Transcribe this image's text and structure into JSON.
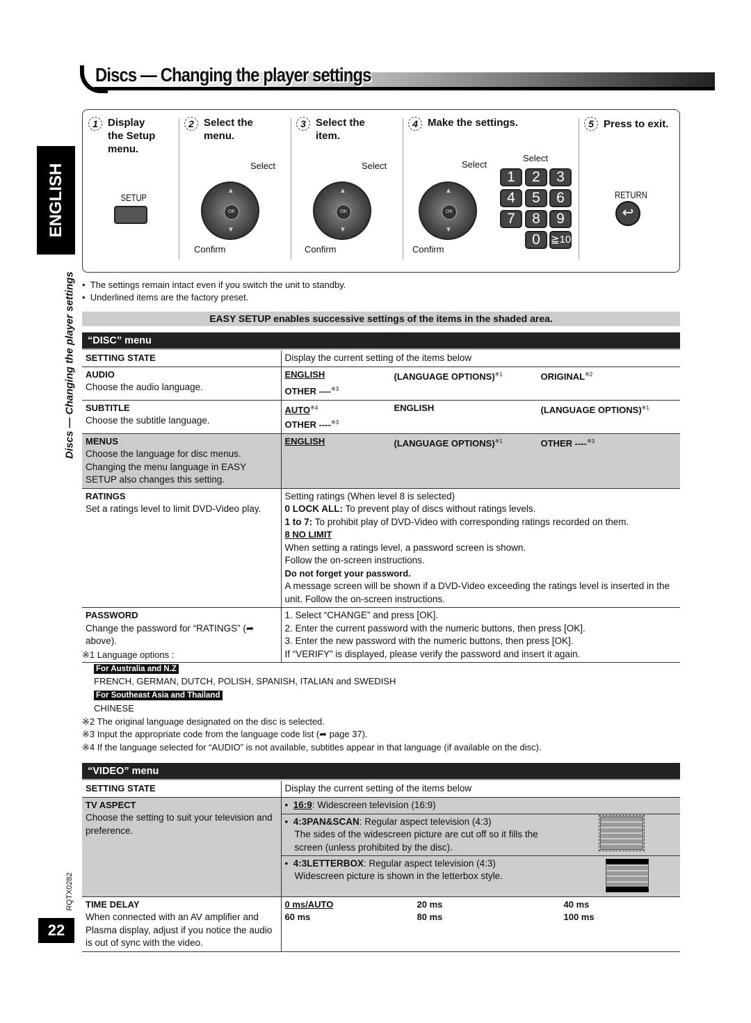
{
  "title": "Discs — Changing the player settings",
  "side_tab": "ENGLISH",
  "side_title": "Discs — Changing the player settings",
  "steps": [
    {
      "num": "1",
      "label": "Display\nthe Setup\nmenu.",
      "button": "SETUP"
    },
    {
      "num": "2",
      "label": "Select the\nmenu.",
      "select": "Select",
      "confirm": "Confirm"
    },
    {
      "num": "3",
      "label": "Select the\nitem.",
      "select": "Select",
      "confirm": "Confirm"
    },
    {
      "num": "4",
      "label": "Make the settings.",
      "select": "Select",
      "confirm": "Confirm",
      "select2": "Select",
      "keys": [
        "1",
        "2",
        "3",
        "4",
        "5",
        "6",
        "7",
        "8",
        "9",
        "0",
        "≧10"
      ]
    },
    {
      "num": "5",
      "label": "Press to exit.",
      "button": "RETURN"
    }
  ],
  "ok_label": "OK",
  "notes": [
    "The settings remain intact even if you switch the unit to standby.",
    "Underlined items are the factory preset."
  ],
  "easy_setup": "EASY SETUP enables successive settings of the items in the shaded area.",
  "disc_menu": {
    "header": "“DISC” menu",
    "setting_state": {
      "title": "SETTING STATE",
      "value": "Display the current setting of the items below"
    },
    "audio": {
      "title": "AUDIO",
      "desc": "Choose the audio language.",
      "o1": "ENGLISH",
      "o2": "(LANGUAGE OPTIONS)",
      "o2n": "※1",
      "o3": "ORIGINAL",
      "o3n": "※2",
      "o4": "OTHER ----",
      "o4n": "※3"
    },
    "subtitle": {
      "title": "SUBTITLE",
      "desc": "Choose the subtitle language.",
      "o1": "AUTO",
      "o1n": "※4",
      "o2": "ENGLISH",
      "o3": "(LANGUAGE OPTIONS)",
      "o3n": "※1",
      "o4": "OTHER ----",
      "o4n": "※3"
    },
    "menus": {
      "title": "MENUS",
      "desc": "Choose the language for disc menus. Changing the menu language in EASY SETUP also changes this setting.",
      "o1": "ENGLISH",
      "o2": "(LANGUAGE OPTIONS)",
      "o2n": "※1",
      "o3": "OTHER ----",
      "o3n": "※3"
    },
    "ratings": {
      "title": "RATINGS",
      "desc": "Set a ratings level to limit DVD-Video play.",
      "l1": "Setting ratings (When level 8 is selected)",
      "l2b": "0 LOCK ALL:",
      "l2": " To prevent play of discs without ratings levels.",
      "l3b": "1 to 7:",
      "l3": " To prohibit play of DVD-Video with corresponding ratings recorded on them.",
      "l4": "8 NO LIMIT",
      "l5": "When setting a ratings level, a password screen is shown.",
      "l6": "Follow the on-screen instructions.",
      "l7": "Do not forget your password.",
      "l8": "A message screen will be shown if a DVD-Video exceeding the ratings level is inserted in the unit. Follow the on-screen instructions."
    },
    "password": {
      "title": "PASSWORD",
      "desc": "Change the password for “RATINGS” (➦ above).",
      "steps": [
        "1. Select “CHANGE” and press [OK].",
        "2. Enter the current password with the numeric buttons, then press [OK].",
        "3. Enter the new password with the numeric buttons, then press [OK].",
        "If “VERIFY” is displayed, please verify the password and insert it again."
      ]
    }
  },
  "footnotes": {
    "n1": "※1 Language options :",
    "region1": "For Australia and N.Z",
    "langs1": "FRENCH, GERMAN, DUTCH, POLISH, SPANISH, ITALIAN and SWEDISH",
    "region2": "For Southeast Asia and Thailand",
    "langs2": "CHINESE",
    "n2": "※2 The original language designated on the disc is selected.",
    "n3": "※3 Input the appropriate code from the language code list (➦ page 37).",
    "n4": "※4 If the language selected for “AUDIO” is not available, subtitles appear in that language (if available on the disc)."
  },
  "video_menu": {
    "header": "“VIDEO” menu",
    "setting_state": {
      "title": "SETTING STATE",
      "value": "Display the current setting of the items below"
    },
    "tv_aspect": {
      "title": "TV ASPECT",
      "desc": "Choose the setting to suit your television and preference.",
      "o1b": "16:9",
      "o1": ": Widescreen television (16:9)",
      "o2b": "4:3PAN&SCAN",
      "o2": ": Regular aspect television (4:3)",
      "o2d": "The sides of the widescreen picture are cut off so it fills the screen (unless prohibited by the disc).",
      "o3b": "4:3LETTERBOX",
      "o3": ": Regular aspect television (4:3)",
      "o3d": "Widescreen picture is shown in the letterbox style."
    },
    "time_delay": {
      "title": "TIME DELAY",
      "desc": "When connected with an AV amplifier and Plasma display, adjust if you notice the audio is out of sync with the video.",
      "opts": [
        "0 ms/AUTO",
        "20 ms",
        "40 ms",
        "60 ms",
        "80 ms",
        "100 ms"
      ]
    }
  },
  "doc_code": "RQTX0282",
  "page_number": "22"
}
